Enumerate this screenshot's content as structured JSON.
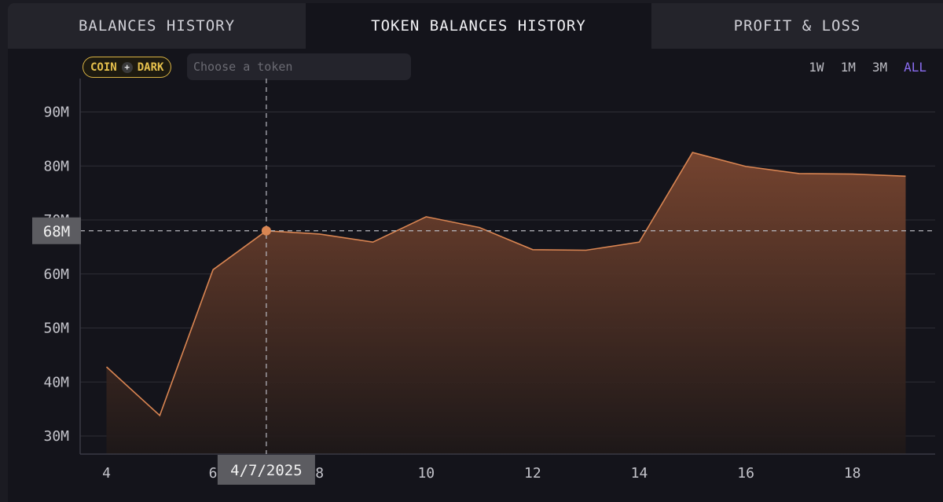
{
  "tabs": [
    {
      "label": "BALANCES HISTORY",
      "active": false
    },
    {
      "label": "TOKEN BALANCES HISTORY",
      "active": true
    },
    {
      "label": "PROFIT & LOSS",
      "active": false
    }
  ],
  "toolbar": {
    "badge_left": "COIN",
    "badge_plus": "+",
    "badge_right": "DARK",
    "token_placeholder": "Choose a token",
    "token_value": "",
    "ranges": [
      {
        "label": "1W",
        "active": false
      },
      {
        "label": "1M",
        "active": false
      },
      {
        "label": "3M",
        "active": false
      },
      {
        "label": "ALL",
        "active": true
      }
    ]
  },
  "colors": {
    "line": "#d98552",
    "fill_top": "#7a4630",
    "fill_bottom": "#1e1818",
    "accent": "#8a6cf0",
    "badge": "#d9b343"
  },
  "chart_data": {
    "type": "area",
    "x": [
      4,
      5,
      6,
      7,
      8,
      9,
      10,
      11,
      12,
      13,
      14,
      15,
      16,
      17,
      18,
      19
    ],
    "values": [
      42.8,
      33.8,
      60.8,
      68,
      67.4,
      65.9,
      70.6,
      68.6,
      64.5,
      64.4,
      65.9,
      82.5,
      79.9,
      78.6,
      78.5,
      78.1
    ],
    "unit": "M",
    "ylim": [
      26.7,
      97
    ],
    "yticks": [
      30,
      40,
      50,
      60,
      70,
      80,
      90
    ],
    "ytick_labels": [
      "30M",
      "40M",
      "50M",
      "60M",
      "70M",
      "80M",
      "90M"
    ],
    "xticks": [
      4,
      6,
      8,
      10,
      12,
      14,
      16,
      18
    ],
    "xtick_labels": [
      "4",
      "6",
      "8",
      "10",
      "12",
      "14",
      "16",
      "18"
    ],
    "xlim": [
      3.5,
      19.5
    ],
    "grid": true,
    "crosshair": {
      "x": 7,
      "value": 68,
      "x_label": "4/7/2025",
      "y_label": "68M"
    }
  }
}
